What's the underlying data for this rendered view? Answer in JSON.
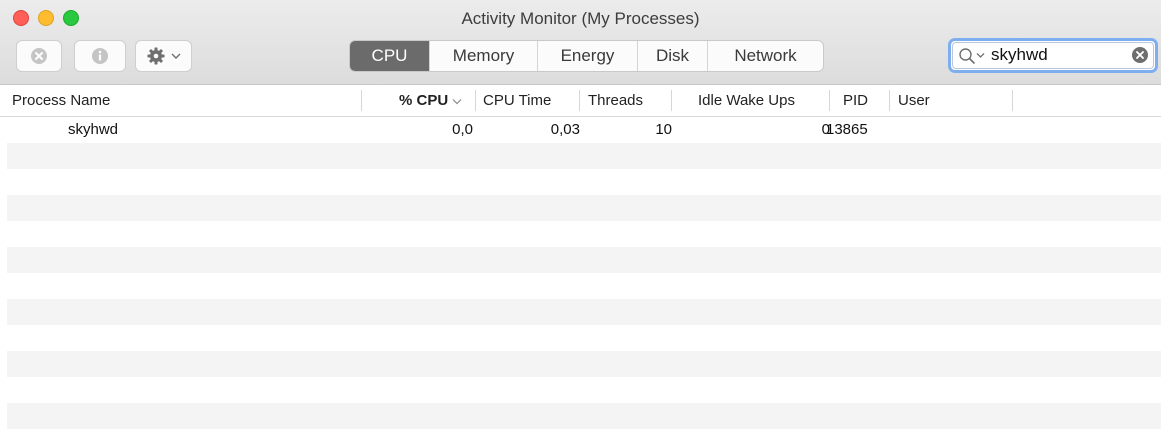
{
  "window": {
    "title": "Activity Monitor (My Processes)"
  },
  "toolbar": {
    "stop_icon": "x-circle-icon",
    "info_icon": "info-icon",
    "actions_icon": "gear-icon"
  },
  "tabs": [
    {
      "label": "CPU",
      "active": true
    },
    {
      "label": "Memory",
      "active": false
    },
    {
      "label": "Energy",
      "active": false
    },
    {
      "label": "Disk",
      "active": false
    },
    {
      "label": "Network",
      "active": false
    }
  ],
  "search": {
    "value": "skyhwd"
  },
  "columns": {
    "process_name": "Process Name",
    "cpu": "% CPU",
    "cpu_time": "CPU Time",
    "threads": "Threads",
    "idle_wake_ups": "Idle Wake Ups",
    "pid": "PID",
    "user": "User"
  },
  "sort_column": "cpu",
  "processes": [
    {
      "name": "skyhwd",
      "cpu": "0,0",
      "cpu_time": "0,03",
      "threads": "10",
      "idle_wake_ups": "0",
      "pid": "13865",
      "user": ""
    }
  ],
  "colors": {
    "active_tab": "#6b6b6b",
    "search_focus": "#7eaef0",
    "row_stripe": "#f4f4f4"
  }
}
